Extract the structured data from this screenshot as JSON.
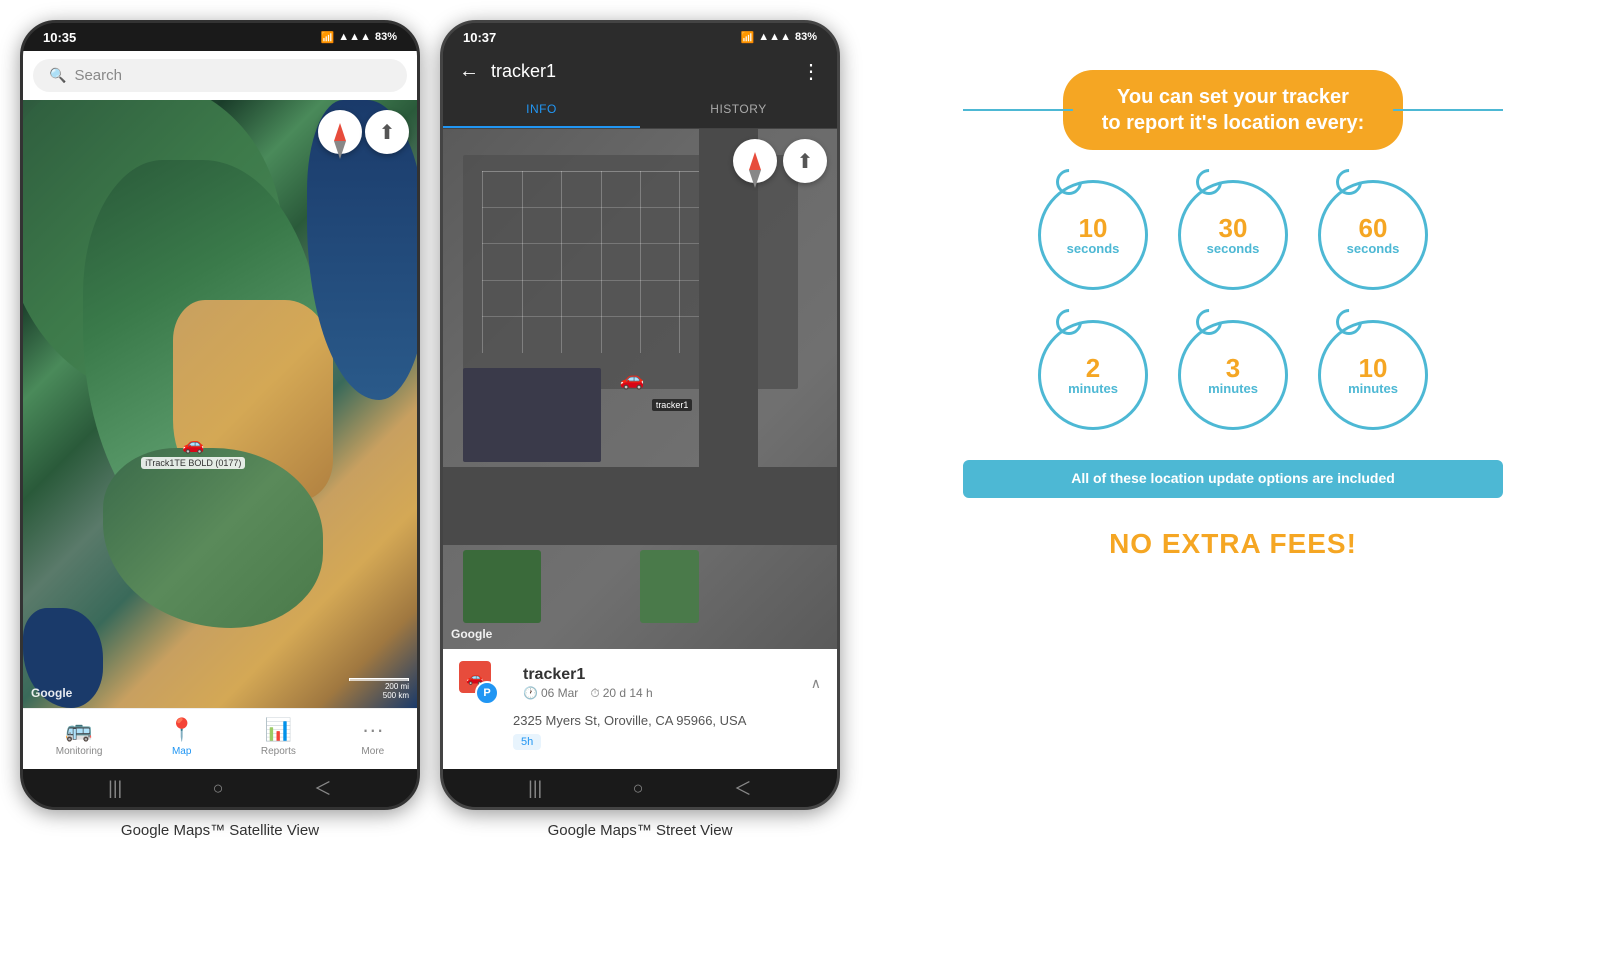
{
  "phones": {
    "left": {
      "status_time": "10:35",
      "signal": "▲▲▲",
      "battery": "83%",
      "search_placeholder": "Search",
      "google_watermark": "Google",
      "scale_200mi": "200 mi",
      "scale_500km": "500 km",
      "pin_label": "iTrack1TE BOLD (0177)",
      "nav_items": [
        {
          "label": "Monitoring",
          "icon": "🚌",
          "active": false
        },
        {
          "label": "Map",
          "icon": "📍",
          "active": true
        },
        {
          "label": "Reports",
          "icon": "📊",
          "active": false
        },
        {
          "label": "More",
          "icon": "···",
          "active": false
        }
      ]
    },
    "right": {
      "status_time": "10:37",
      "signal": "▲▲▲",
      "battery": "83%",
      "tracker_name": "tracker1",
      "tabs": [
        {
          "label": "INFO",
          "active": true
        },
        {
          "label": "HISTORY",
          "active": false
        }
      ],
      "google_watermark": "Google",
      "info_panel": {
        "tracker_name": "tracker1",
        "date": "06 Mar",
        "duration": "20 d 14 h",
        "address": "2325 Myers St, Oroville, CA 95966, USA",
        "badge": "5h"
      }
    }
  },
  "captions": {
    "left": "Google Maps™ Satellite View",
    "right": "Google Maps™ Street View"
  },
  "infographic": {
    "banner_line1": "You can set your tracker",
    "banner_line2": "to report it's location every:",
    "circles": [
      {
        "number": "10",
        "unit": "seconds"
      },
      {
        "number": "30",
        "unit": "seconds"
      },
      {
        "number": "60",
        "unit": "seconds"
      },
      {
        "number": "2",
        "unit": "minutes"
      },
      {
        "number": "3",
        "unit": "minutes"
      },
      {
        "number": "10",
        "unit": "minutes"
      }
    ],
    "included_text": "All of these location update options are included",
    "no_fees_text": "NO EXTRA FEES!",
    "accent_color": "#f5a623",
    "teal_color": "#4db8d4"
  }
}
